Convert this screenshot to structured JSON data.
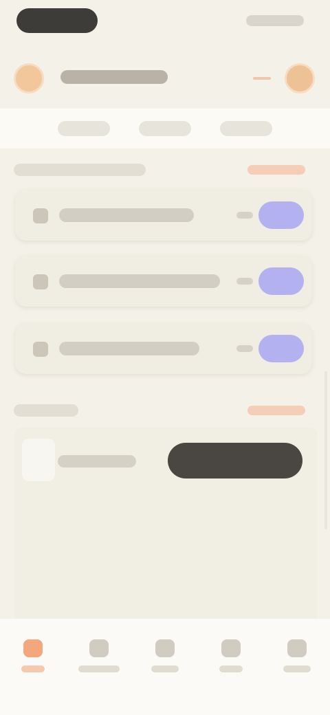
{
  "status_bar": {
    "time": "",
    "right_indicators": ""
  },
  "header": {
    "title": "",
    "avatar_icon": "user-avatar-icon",
    "profile_icon": "profile-icon"
  },
  "tabs": [
    {
      "label": ""
    },
    {
      "label": ""
    },
    {
      "label": ""
    }
  ],
  "section_one": {
    "title": "",
    "link": ""
  },
  "cards": [
    {
      "title": "",
      "meta": "",
      "action": "",
      "icon": "item-icon"
    },
    {
      "title": "",
      "meta": "",
      "action": "",
      "icon": "item-icon"
    },
    {
      "title": "",
      "meta": "",
      "action": "",
      "icon": "item-icon"
    }
  ],
  "section_two": {
    "title": "",
    "link": ""
  },
  "panel": {
    "label": "",
    "button": ""
  },
  "bottom_nav": [
    {
      "label": "",
      "icon": "home-icon",
      "active": true
    },
    {
      "label": "",
      "icon": "grid-icon",
      "active": false
    },
    {
      "label": "",
      "icon": "bookmark-icon",
      "active": false
    },
    {
      "label": "",
      "icon": "calendar-icon",
      "active": false
    },
    {
      "label": "",
      "icon": "user-icon",
      "active": false
    }
  ],
  "colors": {
    "background": "#f4f1e8",
    "accent_orange": "#f4a77d",
    "accent_purple": "#b3b1ef",
    "dark_button": "#4a4743"
  }
}
